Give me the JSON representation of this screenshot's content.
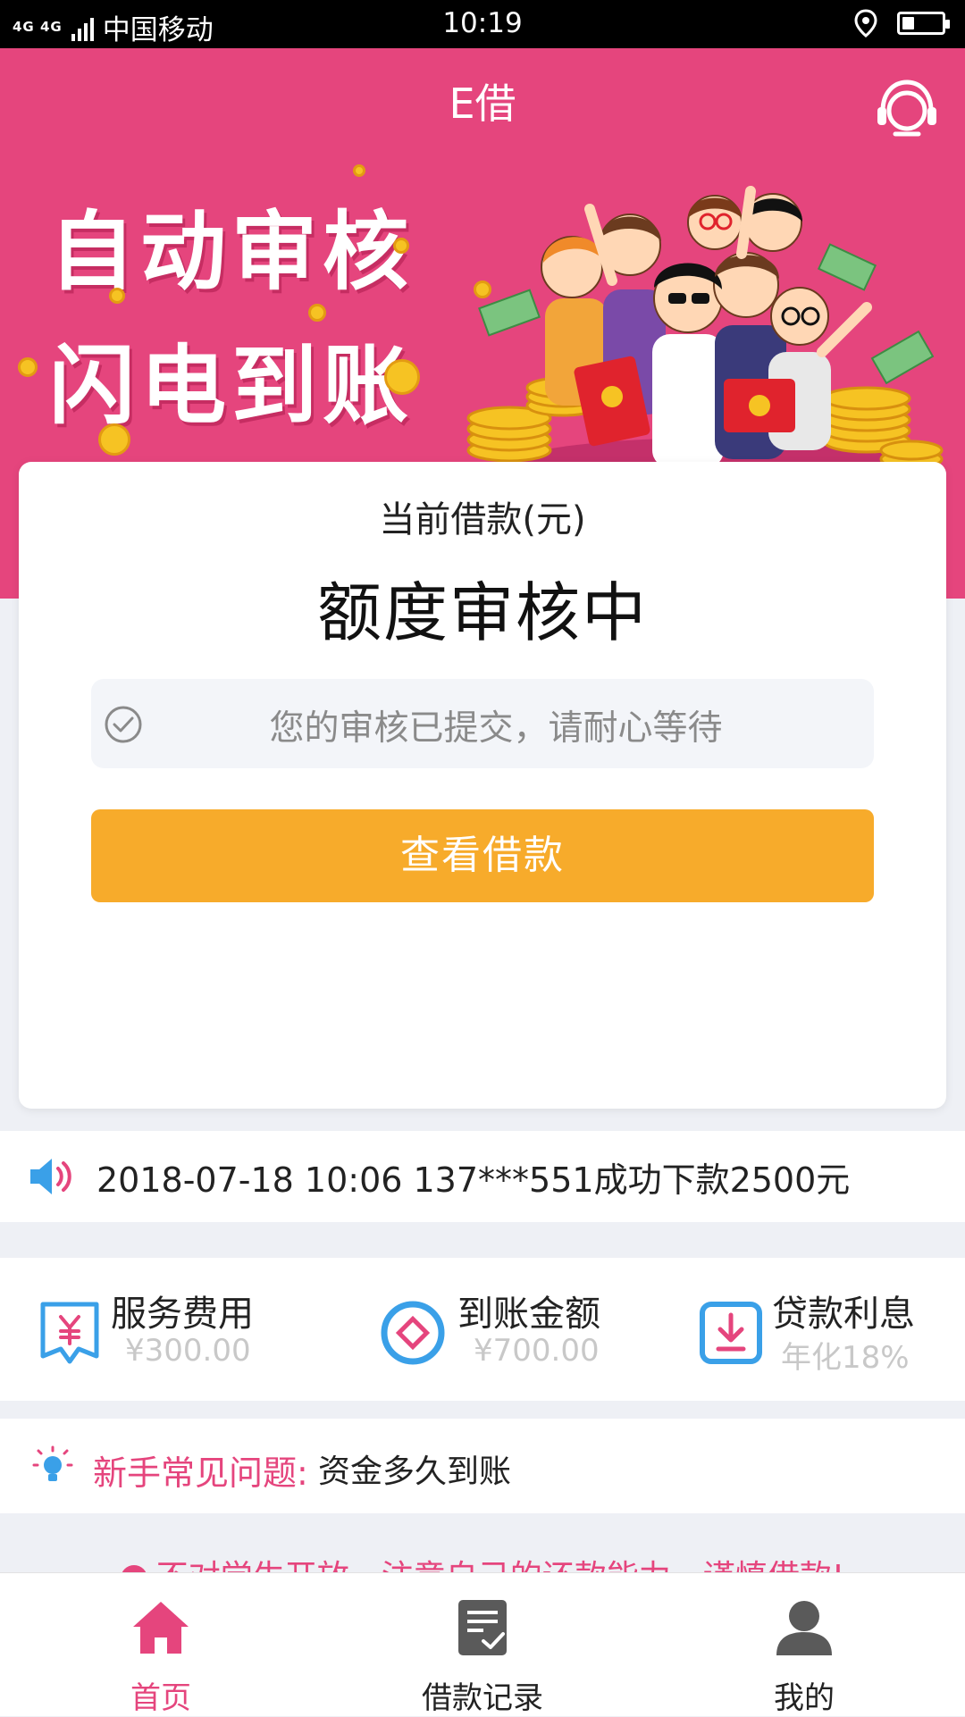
{
  "status_bar": {
    "network": "4G 4G",
    "carrier": "中国移动",
    "time": "10:19",
    "battery_level": 0.3
  },
  "header": {
    "title": "E借",
    "support_icon": "headset-icon"
  },
  "banner": {
    "line1": "自动审核",
    "line2": "闪电到账"
  },
  "card": {
    "caption": "当前借款(元)",
    "status": "额度审核中",
    "notice": "您的审核已提交，请耐心等待",
    "button": "查看借款"
  },
  "ticker": {
    "text": "2018-07-18 10:06 137***551成功下款2500元"
  },
  "stats": [
    {
      "label": "服务费用",
      "value": "¥300.00",
      "icon": "yen-tag-icon"
    },
    {
      "label": "到账金额",
      "value": "¥700.00",
      "icon": "diamond-circle-icon"
    },
    {
      "label": "贷款利息",
      "value": "年化18%",
      "icon": "download-box-icon"
    }
  ],
  "faq": {
    "label": "新手常见问题:",
    "question": "资金多久到账"
  },
  "warning": {
    "text": "不对学生开放，注意自己的还款能力，谨慎借款!"
  },
  "tabs": [
    {
      "label": "首页",
      "icon": "home-icon",
      "active": true
    },
    {
      "label": "借款记录",
      "icon": "record-icon",
      "active": false
    },
    {
      "label": "我的",
      "icon": "user-icon",
      "active": false
    }
  ],
  "colors": {
    "brand": "#e5457d",
    "button": "#f7ab2b",
    "accent_blue": "#3aa0e8"
  }
}
